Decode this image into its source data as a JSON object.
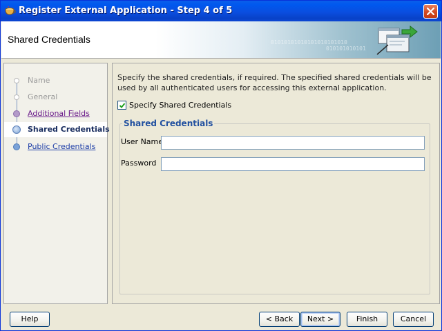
{
  "window": {
    "title": "Register External Application - Step 4 of 5",
    "icon": "app-cup-icon",
    "close_icon": "close-icon"
  },
  "banner": {
    "title": "Shared Credentials",
    "binary_line1": "01010101010101010101010",
    "binary_line2": "010101010101",
    "art_icon": "window-forward-icon"
  },
  "steps": [
    {
      "label": "Name",
      "state": "disabled"
    },
    {
      "label": "General",
      "state": "disabled"
    },
    {
      "label": "Additional Fields",
      "state": "visited"
    },
    {
      "label": "Shared Credentials",
      "state": "current"
    },
    {
      "label": "Public Credentials",
      "state": "link"
    }
  ],
  "content": {
    "description": "Specify the shared credentials, if required. The specified shared credentials will be used by all authenticated users for accessing this external application.",
    "specify_checkbox": {
      "label": "Specify Shared Credentials",
      "checked": true
    },
    "group_title": "Shared Credentials",
    "user_name": {
      "label": "User Name",
      "value": ""
    },
    "password": {
      "label": "Password",
      "value": ""
    }
  },
  "buttons": {
    "help": "Help",
    "back": "< Back",
    "next": "Next >",
    "finish": "Finish",
    "cancel": "Cancel"
  },
  "colors": {
    "titlebar": "#0a4ee0",
    "close_button": "#d24a22",
    "group_title": "#2150a0",
    "link": "#1f3fa8",
    "visited_link": "#6a1b8a"
  }
}
